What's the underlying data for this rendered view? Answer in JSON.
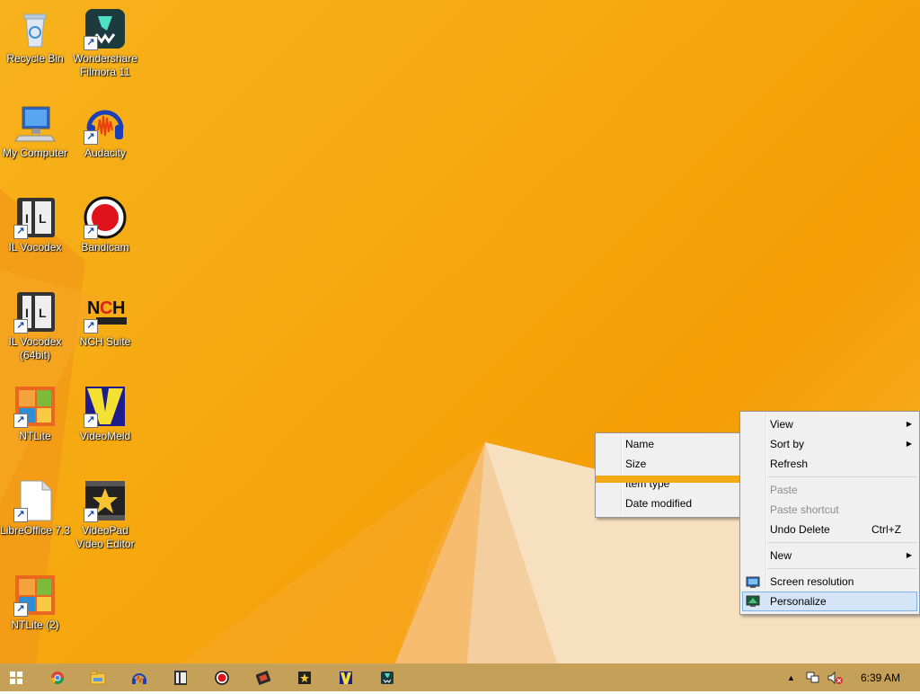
{
  "desktop": {
    "icons": [
      {
        "label": "Recycle Bin",
        "icon": "recycle-bin-icon"
      },
      {
        "label": "Wondershare Filmora 11",
        "icon": "filmora-icon"
      },
      {
        "label": "My Computer",
        "icon": "computer-icon"
      },
      {
        "label": "Audacity",
        "icon": "audacity-icon"
      },
      {
        "label": "IL Vocodex",
        "icon": "il-vocodex-icon"
      },
      {
        "label": "Bandicam",
        "icon": "bandicam-icon"
      },
      {
        "label": "IL Vocodex (64bit)",
        "icon": "il-vocodex-icon"
      },
      {
        "label": "NCH Suite",
        "icon": "nch-icon"
      },
      {
        "label": "NTLite",
        "icon": "ntlite-icon"
      },
      {
        "label": "VideoMeld",
        "icon": "videomeld-icon"
      },
      {
        "label": "LibreOffice 7.3",
        "icon": "libreoffice-icon"
      },
      {
        "label": "VideoPad Video Editor",
        "icon": "videopad-icon"
      },
      {
        "label": "NTLite (2)",
        "icon": "ntlite-icon"
      }
    ]
  },
  "context_menu": {
    "items": [
      {
        "label": "View",
        "submenu": true
      },
      {
        "label": "Sort by",
        "submenu": true
      },
      {
        "label": "Refresh"
      },
      {
        "label": "Paste",
        "disabled": true
      },
      {
        "label": "Paste shortcut",
        "disabled": true
      },
      {
        "label": "Undo Delete",
        "shortcut": "Ctrl+Z"
      },
      {
        "label": "New",
        "submenu": true
      },
      {
        "label": "Screen resolution"
      },
      {
        "label": "Personalize"
      }
    ]
  },
  "sort_submenu": {
    "items": [
      "Name",
      "Size",
      "Item type",
      "Date modified"
    ]
  },
  "taskbar": {
    "apps": [
      "start-icon",
      "chrome-icon",
      "file-explorer-icon",
      "audacity-icon",
      "il-vocodex-icon",
      "bandicam-icon",
      "filmora-icon",
      "videopad-icon",
      "videomeld-icon",
      "filmora-icon"
    ],
    "clock": "6:39 AM"
  },
  "colors": {
    "wallpaper": "#f6a90f",
    "menu_bg": "#f0f0f0",
    "menu_hover": "#d5e5f7",
    "taskbar": "#bf9646"
  }
}
